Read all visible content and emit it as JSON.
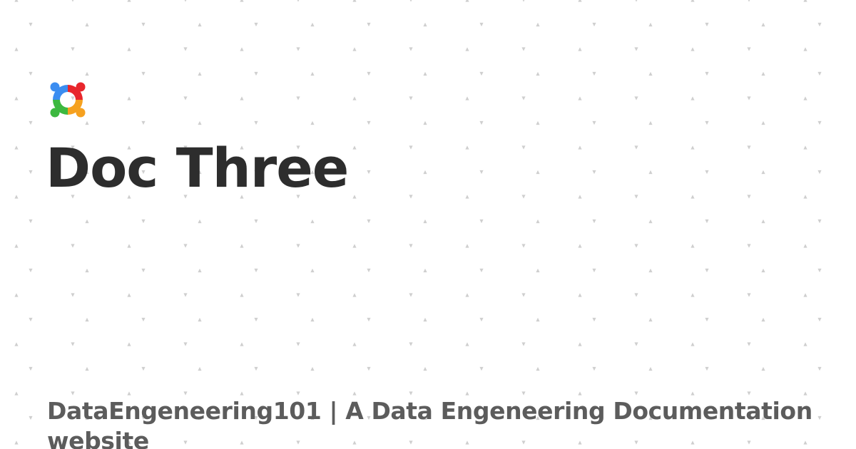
{
  "card": {
    "title": "Doc Three",
    "subtitle": "DataEngeneering101 | A Data Engeneering Documentation website",
    "logo_icon": "docusaurus-color-ring-icon"
  },
  "colors": {
    "background": "#ffffff",
    "title": "#2d2d2d",
    "subtitle": "#5c5c5c",
    "dot": "#cfcfcf",
    "logo_blue": "#3b8df1",
    "logo_red": "#e8262c",
    "logo_green": "#3cb83f",
    "logo_orange": "#f6a11f"
  }
}
